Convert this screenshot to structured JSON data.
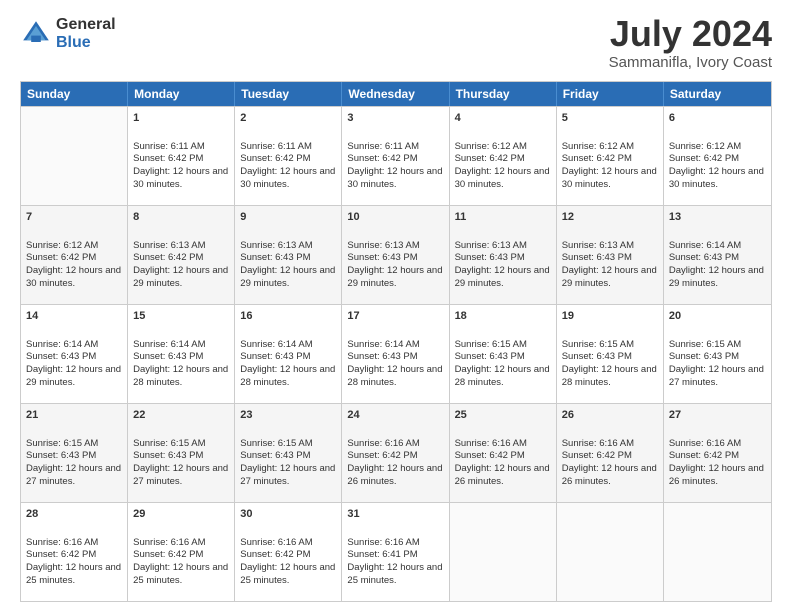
{
  "logo": {
    "general": "General",
    "blue": "Blue"
  },
  "title": {
    "month_year": "July 2024",
    "location": "Sammanifla, Ivory Coast"
  },
  "days_of_week": [
    "Sunday",
    "Monday",
    "Tuesday",
    "Wednesday",
    "Thursday",
    "Friday",
    "Saturday"
  ],
  "weeks": [
    [
      {
        "day": "",
        "empty": true
      },
      {
        "day": "1",
        "sunrise": "Sunrise: 6:11 AM",
        "sunset": "Sunset: 6:42 PM",
        "daylight": "Daylight: 12 hours and 30 minutes."
      },
      {
        "day": "2",
        "sunrise": "Sunrise: 6:11 AM",
        "sunset": "Sunset: 6:42 PM",
        "daylight": "Daylight: 12 hours and 30 minutes."
      },
      {
        "day": "3",
        "sunrise": "Sunrise: 6:11 AM",
        "sunset": "Sunset: 6:42 PM",
        "daylight": "Daylight: 12 hours and 30 minutes."
      },
      {
        "day": "4",
        "sunrise": "Sunrise: 6:12 AM",
        "sunset": "Sunset: 6:42 PM",
        "daylight": "Daylight: 12 hours and 30 minutes."
      },
      {
        "day": "5",
        "sunrise": "Sunrise: 6:12 AM",
        "sunset": "Sunset: 6:42 PM",
        "daylight": "Daylight: 12 hours and 30 minutes."
      },
      {
        "day": "6",
        "sunrise": "Sunrise: 6:12 AM",
        "sunset": "Sunset: 6:42 PM",
        "daylight": "Daylight: 12 hours and 30 minutes."
      }
    ],
    [
      {
        "day": "7",
        "sunrise": "Sunrise: 6:12 AM",
        "sunset": "Sunset: 6:42 PM",
        "daylight": "Daylight: 12 hours and 30 minutes."
      },
      {
        "day": "8",
        "sunrise": "Sunrise: 6:13 AM",
        "sunset": "Sunset: 6:42 PM",
        "daylight": "Daylight: 12 hours and 29 minutes."
      },
      {
        "day": "9",
        "sunrise": "Sunrise: 6:13 AM",
        "sunset": "Sunset: 6:43 PM",
        "daylight": "Daylight: 12 hours and 29 minutes."
      },
      {
        "day": "10",
        "sunrise": "Sunrise: 6:13 AM",
        "sunset": "Sunset: 6:43 PM",
        "daylight": "Daylight: 12 hours and 29 minutes."
      },
      {
        "day": "11",
        "sunrise": "Sunrise: 6:13 AM",
        "sunset": "Sunset: 6:43 PM",
        "daylight": "Daylight: 12 hours and 29 minutes."
      },
      {
        "day": "12",
        "sunrise": "Sunrise: 6:13 AM",
        "sunset": "Sunset: 6:43 PM",
        "daylight": "Daylight: 12 hours and 29 minutes."
      },
      {
        "day": "13",
        "sunrise": "Sunrise: 6:14 AM",
        "sunset": "Sunset: 6:43 PM",
        "daylight": "Daylight: 12 hours and 29 minutes."
      }
    ],
    [
      {
        "day": "14",
        "sunrise": "Sunrise: 6:14 AM",
        "sunset": "Sunset: 6:43 PM",
        "daylight": "Daylight: 12 hours and 29 minutes."
      },
      {
        "day": "15",
        "sunrise": "Sunrise: 6:14 AM",
        "sunset": "Sunset: 6:43 PM",
        "daylight": "Daylight: 12 hours and 28 minutes."
      },
      {
        "day": "16",
        "sunrise": "Sunrise: 6:14 AM",
        "sunset": "Sunset: 6:43 PM",
        "daylight": "Daylight: 12 hours and 28 minutes."
      },
      {
        "day": "17",
        "sunrise": "Sunrise: 6:14 AM",
        "sunset": "Sunset: 6:43 PM",
        "daylight": "Daylight: 12 hours and 28 minutes."
      },
      {
        "day": "18",
        "sunrise": "Sunrise: 6:15 AM",
        "sunset": "Sunset: 6:43 PM",
        "daylight": "Daylight: 12 hours and 28 minutes."
      },
      {
        "day": "19",
        "sunrise": "Sunrise: 6:15 AM",
        "sunset": "Sunset: 6:43 PM",
        "daylight": "Daylight: 12 hours and 28 minutes."
      },
      {
        "day": "20",
        "sunrise": "Sunrise: 6:15 AM",
        "sunset": "Sunset: 6:43 PM",
        "daylight": "Daylight: 12 hours and 27 minutes."
      }
    ],
    [
      {
        "day": "21",
        "sunrise": "Sunrise: 6:15 AM",
        "sunset": "Sunset: 6:43 PM",
        "daylight": "Daylight: 12 hours and 27 minutes."
      },
      {
        "day": "22",
        "sunrise": "Sunrise: 6:15 AM",
        "sunset": "Sunset: 6:43 PM",
        "daylight": "Daylight: 12 hours and 27 minutes."
      },
      {
        "day": "23",
        "sunrise": "Sunrise: 6:15 AM",
        "sunset": "Sunset: 6:43 PM",
        "daylight": "Daylight: 12 hours and 27 minutes."
      },
      {
        "day": "24",
        "sunrise": "Sunrise: 6:16 AM",
        "sunset": "Sunset: 6:42 PM",
        "daylight": "Daylight: 12 hours and 26 minutes."
      },
      {
        "day": "25",
        "sunrise": "Sunrise: 6:16 AM",
        "sunset": "Sunset: 6:42 PM",
        "daylight": "Daylight: 12 hours and 26 minutes."
      },
      {
        "day": "26",
        "sunrise": "Sunrise: 6:16 AM",
        "sunset": "Sunset: 6:42 PM",
        "daylight": "Daylight: 12 hours and 26 minutes."
      },
      {
        "day": "27",
        "sunrise": "Sunrise: 6:16 AM",
        "sunset": "Sunset: 6:42 PM",
        "daylight": "Daylight: 12 hours and 26 minutes."
      }
    ],
    [
      {
        "day": "28",
        "sunrise": "Sunrise: 6:16 AM",
        "sunset": "Sunset: 6:42 PM",
        "daylight": "Daylight: 12 hours and 25 minutes."
      },
      {
        "day": "29",
        "sunrise": "Sunrise: 6:16 AM",
        "sunset": "Sunset: 6:42 PM",
        "daylight": "Daylight: 12 hours and 25 minutes."
      },
      {
        "day": "30",
        "sunrise": "Sunrise: 6:16 AM",
        "sunset": "Sunset: 6:42 PM",
        "daylight": "Daylight: 12 hours and 25 minutes."
      },
      {
        "day": "31",
        "sunrise": "Sunrise: 6:16 AM",
        "sunset": "Sunset: 6:41 PM",
        "daylight": "Daylight: 12 hours and 25 minutes."
      },
      {
        "day": "",
        "empty": true
      },
      {
        "day": "",
        "empty": true
      },
      {
        "day": "",
        "empty": true
      }
    ]
  ]
}
